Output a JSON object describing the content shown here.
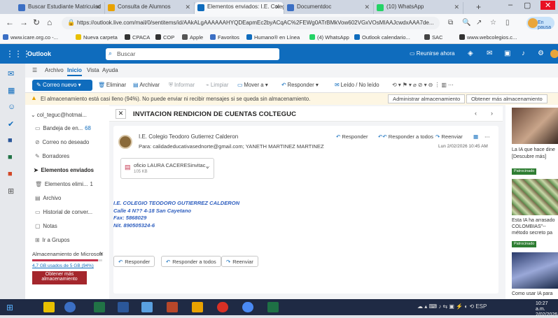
{
  "browser": {
    "tabs": [
      {
        "label": "Buscar Estudiante Matriculad",
        "color": "#3b6fc4",
        "active": false
      },
      {
        "label": "Consulta de Alumnos",
        "color": "#e8a200",
        "active": false
      },
      {
        "label": "Elementos enviados: I.E. Coleg",
        "color": "#0f6cbd",
        "active": true
      },
      {
        "label": "Documentdoc",
        "color": "#3b6fc4",
        "active": false
      },
      {
        "label": "(10) WhatsApp",
        "color": "#25d366",
        "active": false
      }
    ],
    "url": "https://outlook.live.com/mail/0/sentitems/id/AAkALgAAAAAAHYQDEapmEc2byACqAC%2FEWg0ATrBMkVow602VGxVOsMIAAJcwdxAAA7de...",
    "profile_label": "En pausa",
    "bookmarks": [
      {
        "label": "www.icare.org.co -...",
        "color": "#3b6fc4"
      },
      {
        "label": "Nueva carpeta",
        "color": "#e8c000"
      },
      {
        "label": "CPACA",
        "color": "#333333"
      },
      {
        "label": "COP",
        "color": "#333333"
      },
      {
        "label": "Apple",
        "color": "#555555"
      },
      {
        "label": "Favoritos",
        "color": "#3b6fc4"
      },
      {
        "label": "Humano® en Línea",
        "color": "#0f6cbd"
      },
      {
        "label": "(4) WhatsApp",
        "color": "#25d366"
      },
      {
        "label": "Outlook calendario...",
        "color": "#0f6cbd"
      },
      {
        "label": "SAC",
        "color": "#444444"
      },
      {
        "label": "www.webcolegios.c...",
        "color": "#333333"
      }
    ]
  },
  "outlook": {
    "brand": "Outlook",
    "search_placeholder": "Buscar",
    "meet_now": "Reunirse ahora",
    "ribbon_tabs": [
      "Archivo",
      "Inicio",
      "Vista",
      "Ayuda"
    ],
    "active_ribbon_tab": "Inicio",
    "toolbar": {
      "new_mail": "Correo nuevo",
      "delete": "Eliminar",
      "archive": "Archivar",
      "report": "Informar",
      "sweep": "Limpiar",
      "move": "Mover a",
      "reply": "Responder",
      "read_unread": "Leído / No leído"
    },
    "warning": {
      "text": "El almacenamiento está casi lleno (94%). No puede enviar ni recibir mensajes si se queda sin almacenamiento.",
      "manage_button": "Administrar almacenamiento",
      "get_more_button": "Obtener más almacenamiento"
    },
    "folders": {
      "account": "col_teguc@hotmai...",
      "items": [
        {
          "label": "Bandeja de en...",
          "count": "68",
          "icon": "inbox-icon",
          "glyph": "▭"
        },
        {
          "label": "Correo no deseado",
          "count": "",
          "icon": "junk-icon",
          "glyph": "⊘"
        },
        {
          "label": "Borradores",
          "count": "",
          "icon": "draft-icon",
          "glyph": "✎"
        },
        {
          "label": "Elementos enviados",
          "count": "",
          "icon": "sent-icon",
          "glyph": "➤"
        },
        {
          "label": "Elementos elimi...",
          "count": "1",
          "icon": "trash-icon",
          "glyph": "🗑"
        },
        {
          "label": "Archivo",
          "count": "",
          "icon": "archive-icon",
          "glyph": "▤"
        },
        {
          "label": "Historial de conver...",
          "count": "",
          "icon": "history-icon",
          "glyph": "▭"
        },
        {
          "label": "Notas",
          "count": "",
          "icon": "notes-icon",
          "glyph": "▢"
        },
        {
          "label": "Ir a Grupos",
          "count": "",
          "icon": "groups-icon",
          "glyph": "⊞"
        }
      ],
      "storage_title": "Almacenamiento de Microsoft",
      "storage_used_fraction": 0.94,
      "storage_link": "4,7 GB usados de 5 GB (94%)",
      "get_more": "Obtener más almacenamiento"
    },
    "message": {
      "subject": "INVITACION RENDICION DE CUENTAS COLTEGUC",
      "sender": "I.E. Colegio Teodoro Gutierrez Calderon",
      "to_label": "Para:",
      "to_recipients": "calidadeducativasednorte@gmail.com;  YANETH MARTINEZ MARTINEZ",
      "reply": "Responder",
      "reply_all": "Responder a todos",
      "forward": "Reenviar",
      "date": "Lun 2/02/2026 10:45 AM",
      "attachment_name": "oficio LAURA CACERESinvitac...",
      "attachment_size": "105 KB",
      "signature": [
        "I.E. COLEGIO TEODORO GUTIERREZ CALDERON",
        "Calle 4 N?? 4-18 San Cayetano",
        "Fax: 5868029",
        "Nit. 890505324-6"
      ]
    },
    "ads": [
      {
        "caption_1": "La IA que hace dine",
        "caption_2": "[Descubre más]",
        "tag": "Patrocinado"
      },
      {
        "caption_1": "Esta IA ha arrasado",
        "caption_2": "COLOMBIAS\"--",
        "caption_3": "método secreto pa",
        "tag": "Patrocinado"
      },
      {
        "caption_1": "Como usar IA para"
      }
    ]
  },
  "taskbar": {
    "time": "10:27 a.m.",
    "date": "2/02/2026",
    "lang": "ESP"
  }
}
